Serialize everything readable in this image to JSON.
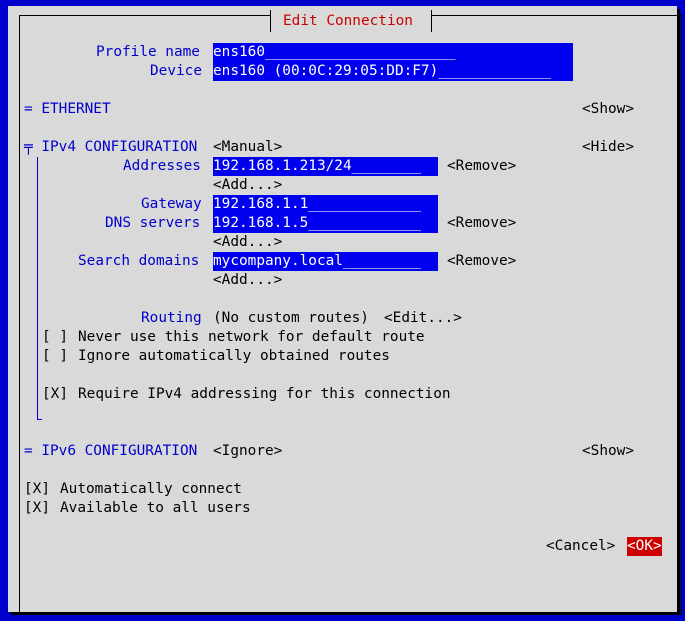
{
  "title": "Edit Connection",
  "profile": {
    "label": "Profile name",
    "value": "ens160______________________"
  },
  "device": {
    "label": "Device",
    "value": "ens160 (00:0C:29:05:DD:F7)_____________"
  },
  "ethernet": {
    "label": "= ETHERNET",
    "action": "<Show>"
  },
  "ipv4": {
    "label": "╤ IPv4 CONFIGURATION",
    "mode": "<Manual>",
    "action": "<Hide>",
    "addresses_label": "Addresses",
    "addresses_value": "192.168.1.213/24________",
    "addresses_remove": "<Remove>",
    "addresses_add": "<Add...>",
    "gateway_label": "Gateway",
    "gateway_value": "192.168.1.1_____________",
    "dns_label": "DNS servers",
    "dns_value": "192.168.1.5_____________",
    "dns_remove": "<Remove>",
    "dns_add": "<Add...>",
    "search_label": "Search domains",
    "search_value": "mycompany.local_________",
    "search_remove": "<Remove>",
    "search_add": "<Add...>",
    "routing_label": "Routing",
    "routing_value": "(No custom routes)",
    "routing_edit": "<Edit...>",
    "never_default_box": "[ ]",
    "never_default_label": "Never use this network for default route",
    "ignore_routes_box": "[ ]",
    "ignore_routes_label": "Ignore automatically obtained routes",
    "require_box": "[X]",
    "require_label": "Require IPv4 addressing for this connection"
  },
  "ipv6": {
    "label": "= IPv6 CONFIGURATION",
    "mode": "<Ignore>",
    "action": "<Show>"
  },
  "auto_connect": {
    "box": "[X]",
    "label": "Automatically connect"
  },
  "all_users": {
    "box": "[X]",
    "label": "Available to all users"
  },
  "buttons": {
    "cancel": "<Cancel>",
    "ok": "<OK>"
  },
  "colors": {
    "background": "#0000cc",
    "dialog": "#d9d9d9",
    "field": "#0000ee",
    "accent": "#cc0000"
  }
}
